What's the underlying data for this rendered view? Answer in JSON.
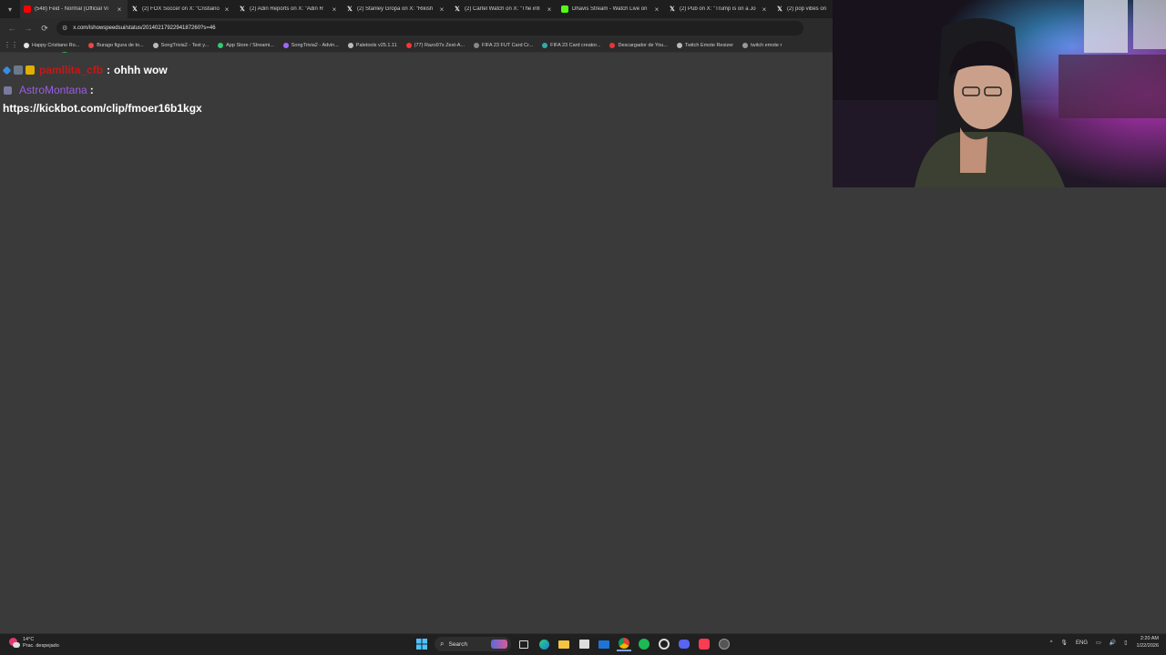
{
  "browser": {
    "tabs": [
      {
        "title": "(548) Feid - Normal (Official Vi",
        "icon": "youtube-icon",
        "color": "#ff0000",
        "active": true
      },
      {
        "title": "(2) FOX Soccer on X: \"Cristiano",
        "icon": "x-icon",
        "color": "#000000"
      },
      {
        "title": "(2) Adin Reports on X: \"Adin R",
        "icon": "x-icon",
        "color": "#000000"
      },
      {
        "title": "(2) Stanley Gropa on X: \"Rikish",
        "icon": "x-icon",
        "color": "#000000"
      },
      {
        "title": "(2) Cartel Watch on X: \"The infi",
        "icon": "x-icon",
        "color": "#000000"
      },
      {
        "title": "Dhavis Stream - Watch Live on",
        "icon": "kick-icon",
        "color": "#53fc18"
      },
      {
        "title": "(2) Pub on X: \"Trump is on a Jo",
        "icon": "x-icon",
        "color": "#000000"
      },
      {
        "title": "(2) pop vibes on",
        "icon": "x-icon",
        "color": "#000000"
      }
    ],
    "url": "x.com/ishowspeedsui/status/2014021792294187260?s=46",
    "bookmarks": [
      {
        "label": "Happy Cristiano Ro...",
        "color": "#e5e5e5"
      },
      {
        "label": "Burago figura de to...",
        "color": "#e44"
      },
      {
        "label": "SongTrivia2 - Test y...",
        "color": "#bbb"
      },
      {
        "label": "App Store / Streami...",
        "color": "#2ecc71"
      },
      {
        "label": "SongTrivia2 - Advin...",
        "color": "#a066ff"
      },
      {
        "label": "Paletools v25.1.11",
        "color": "#bbb"
      },
      {
        "label": "(77) Razo97s Zest-A...",
        "color": "#ff3333"
      },
      {
        "label": "FIFA 23 FUT Card Cr...",
        "color": "#888"
      },
      {
        "label": "FIFA 23 Card creator...",
        "color": "#3aa"
      },
      {
        "label": "Descargador de You...",
        "color": "#e33"
      },
      {
        "label": "Twitch Emote Resizer",
        "color": "#bbb"
      },
      {
        "label": "twitch emote r",
        "color": "#999"
      }
    ]
  },
  "chat": {
    "message1": {
      "user": "pamllita_cfb",
      "text": "ohhh wow",
      "user_color": "#c41818"
    },
    "message2": {
      "user": "AstroMontana",
      "colon": ":",
      "user_color": "#9b5de5"
    },
    "link": "https://kickbot.com/clip/fmoer16b1kgx"
  },
  "taskbar": {
    "weather_temp": "14°C",
    "weather_desc": "Prac. despejado",
    "search_label": "Search",
    "lang": "ENG",
    "time": "2:20 AM",
    "date": "1/22/2026"
  }
}
